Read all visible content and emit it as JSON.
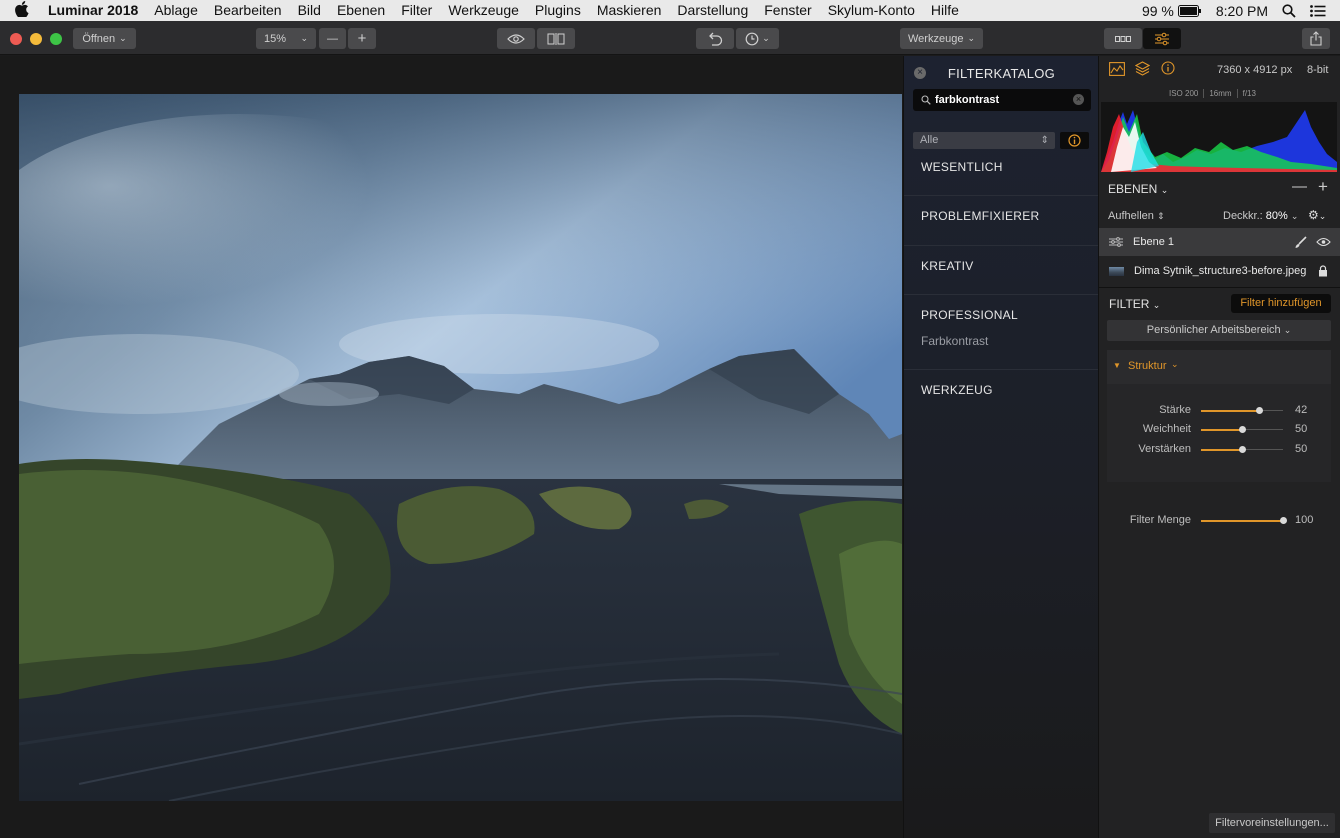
{
  "menubar": {
    "app": "Luminar 2018",
    "items": [
      "Ablage",
      "Bearbeiten",
      "Bild",
      "Ebenen",
      "Filter",
      "Werkzeuge",
      "Plugins",
      "Maskieren",
      "Darstellung",
      "Fenster",
      "Skylum-Konto",
      "Hilfe"
    ],
    "battery": "99 %",
    "time": "8:20 PM"
  },
  "toolbar": {
    "open_label": "Öffnen",
    "zoom": "15%",
    "zoom_minus": "—",
    "zoom_plus": "+",
    "tools_label": "Werkzeuge"
  },
  "catalog": {
    "title": "FILTERKATALOG",
    "search_value": "farbkontrast",
    "filter_select": "Alle",
    "categories": [
      {
        "label": "WESENTLICH",
        "sub": ""
      },
      {
        "label": "PROBLEMFIXIERER",
        "sub": ""
      },
      {
        "label": "KREATIV",
        "sub": ""
      },
      {
        "label": "PROFESSIONAL",
        "sub": "Farbkontrast"
      },
      {
        "label": "WERKZEUG",
        "sub": ""
      }
    ]
  },
  "info": {
    "dimensions": "7360 x 4912 px",
    "bitdepth": "8-bit",
    "iso": "ISO 200",
    "focal": "16mm",
    "aperture": "f/13"
  },
  "layers": {
    "header": "EBENEN",
    "blend_mode": "Aufhellen",
    "opacity_label": "Deckkr.:",
    "opacity_value": "80%",
    "layer1": "Ebene 1",
    "base_layer": "Dima Sytnik_structure3-before.jpeg"
  },
  "filters": {
    "header": "FILTER",
    "add_button": "Filter hinzufügen",
    "workspace": "Persönlicher Arbeitsbereich",
    "filter_name": "Struktur",
    "sliders": [
      {
        "label": "Stärke",
        "value": "42",
        "fraction": 0.71
      },
      {
        "label": "Weichheit",
        "value": "50",
        "fraction": 0.5
      },
      {
        "label": "Verstärken",
        "value": "50",
        "fraction": 0.5
      }
    ],
    "amount_label": "Filter Menge",
    "amount_value": "100",
    "amount_fraction": 1.0,
    "presets_button": "Filtervoreinstellungen..."
  },
  "colors": {
    "accent": "#e0962a",
    "catalog_bg": "#1d2230",
    "panel_bg": "#222223"
  }
}
